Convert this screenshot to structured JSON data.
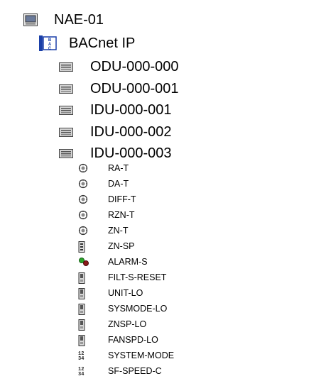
{
  "tree": {
    "root": {
      "label": "NAE-01",
      "icon": "device-icon"
    },
    "network": {
      "label": "BACnet IP",
      "icon": "bacnet-network-icon",
      "icon_text": "BAC"
    },
    "devices": [
      {
        "label": "ODU-000-000",
        "icon": "device-icon"
      },
      {
        "label": "ODU-000-001",
        "icon": "device-icon"
      },
      {
        "label": "IDU-000-001",
        "icon": "device-icon"
      },
      {
        "label": "IDU-000-002",
        "icon": "device-icon"
      },
      {
        "label": "IDU-000-003",
        "icon": "device-icon",
        "expanded": true
      }
    ],
    "points": [
      {
        "label": "RA-T",
        "icon": "analog-input-icon"
      },
      {
        "label": "DA-T",
        "icon": "analog-input-icon"
      },
      {
        "label": "DIFF-T",
        "icon": "analog-input-icon"
      },
      {
        "label": "RZN-T",
        "icon": "analog-input-icon"
      },
      {
        "label": "ZN-T",
        "icon": "analog-input-icon"
      },
      {
        "label": "ZN-SP",
        "icon": "analog-value-icon"
      },
      {
        "label": "ALARM-S",
        "icon": "binary-input-icon"
      },
      {
        "label": "FILT-S-RESET",
        "icon": "binary-output-icon"
      },
      {
        "label": "UNIT-LO",
        "icon": "binary-output-icon"
      },
      {
        "label": "SYSMODE-LO",
        "icon": "binary-output-icon"
      },
      {
        "label": "ZNSP-LO",
        "icon": "binary-output-icon"
      },
      {
        "label": "FANSPD-LO",
        "icon": "binary-output-icon"
      },
      {
        "label": "SYSTEM-MODE",
        "icon": "multistate-value-icon"
      },
      {
        "label": "SF-SPEED-C",
        "icon": "multistate-value-icon"
      }
    ]
  },
  "colors": {
    "device_icon_fill": "#c8c8c8",
    "bacnet_blue": "#1a3fa8",
    "alarm_green": "#2aa52a",
    "alarm_red": "#8b1a1a"
  }
}
